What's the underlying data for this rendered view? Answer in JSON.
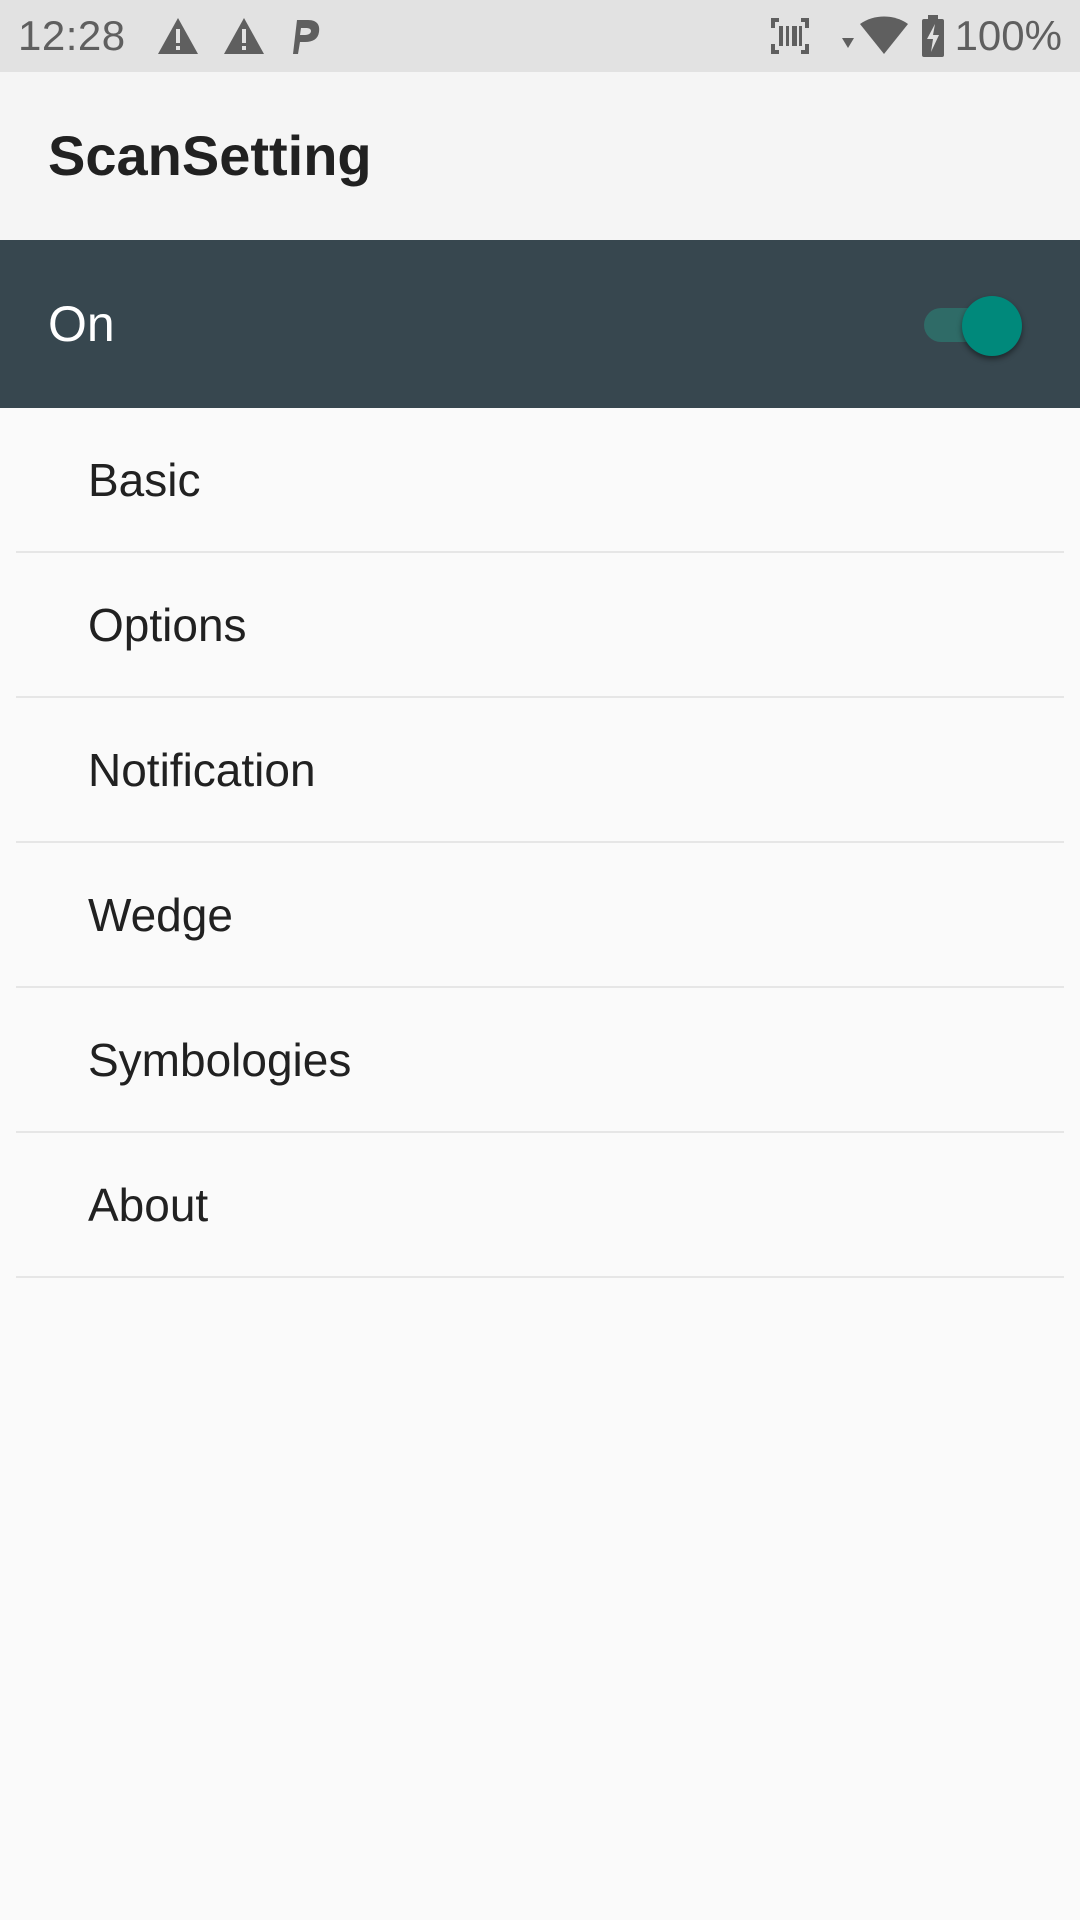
{
  "status_bar": {
    "time": "12:28",
    "left_icons": [
      "warning-icon",
      "warning-icon",
      "parking-icon"
    ],
    "right_icons": [
      "barcode-scanner-icon",
      "wifi-icon",
      "battery-charging-icon"
    ],
    "battery_percent": "100%"
  },
  "app_bar": {
    "title": "ScanSetting"
  },
  "master_switch": {
    "label": "On",
    "checked": true,
    "accent_color": "#00897b",
    "background_color": "#37474f"
  },
  "menu": {
    "items": [
      {
        "label": "Basic"
      },
      {
        "label": "Options"
      },
      {
        "label": "Notification"
      },
      {
        "label": "Wedge"
      },
      {
        "label": "Symbologies"
      },
      {
        "label": "About"
      }
    ]
  }
}
